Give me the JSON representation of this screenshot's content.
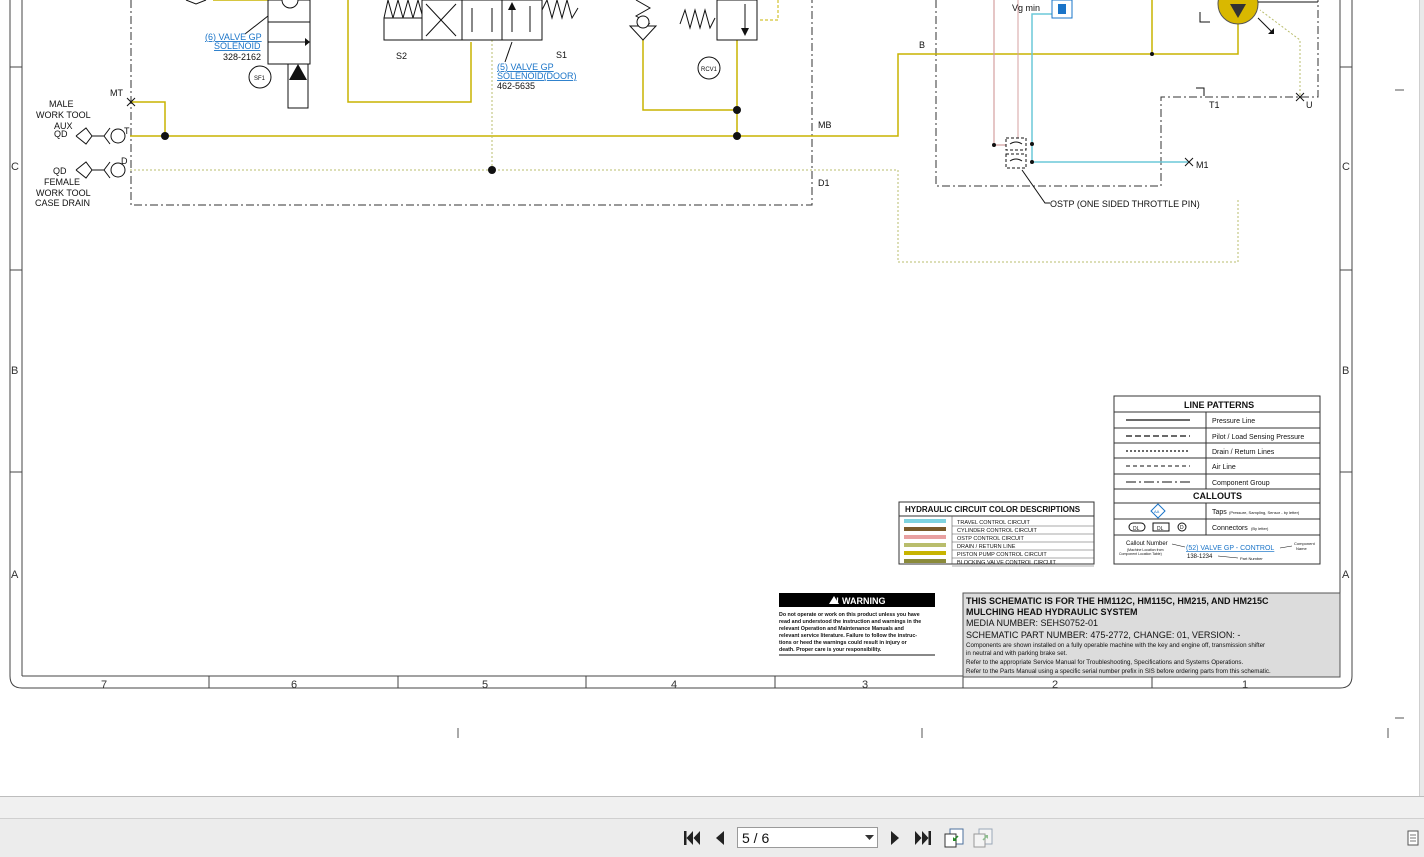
{
  "schematic": {
    "border_columns": [
      "7",
      "6",
      "5",
      "4",
      "3",
      "2",
      "1"
    ],
    "border_rows": [
      "C",
      "B",
      "A"
    ],
    "labels": {
      "valve6_link": "(6) VALVE GP",
      "valve6_link2": "SOLENOID",
      "valve6_part": "328-2162",
      "sf1": "SF1",
      "s2": "S2",
      "s1": "S1",
      "valve5_link": "(5) VALVE GP",
      "valve5_link2": "SOLENOID(DOOR)",
      "valve5_part": "462-5635",
      "rcv1": "RCV1",
      "mt": "MT",
      "male1": "MALE",
      "male2": "WORK TOOL",
      "aux": "AUX",
      "qd1": "QD",
      "t": "T",
      "qd2": "QD",
      "d": "D",
      "female1": "FEMALE",
      "female2": "WORK TOOL",
      "female3": "CASE DRAIN",
      "mb": "MB",
      "d1": "D1",
      "b": "B",
      "vgmin": "Vg min",
      "t1": "T1",
      "u": "U",
      "m1": "M1",
      "ostp": "OSTP (ONE SIDED THROTTLE PIN)"
    },
    "color_legend": {
      "title": "HYDRAULIC CIRCUIT COLOR DESCRIPTIONS",
      "items": [
        {
          "label": "TRAVEL CONTROL CIRCUIT",
          "color": "#7fd3e0"
        },
        {
          "label": "CYLINDER CONTROL CIRCUIT",
          "color": "#7a5a2a"
        },
        {
          "label": "OSTP CONTROL CIRCUIT",
          "color": "#e8a0a0"
        },
        {
          "label": "DRAIN / RETURN LINE",
          "color": "#b9bd6c"
        },
        {
          "label": "PISTON PUMP CONTROL CIRCUIT",
          "color": "#c8b400"
        },
        {
          "label": "BLOCKING VALVE CONTROL CIRCUIT",
          "color": "#8a8a3a"
        }
      ]
    },
    "line_patterns": {
      "title": "LINE PATTERNS",
      "items": [
        "Pressure Line",
        "Pilot / Load Sensing Pressure",
        "Drain / Return Lines",
        "Air Line",
        "Component Group"
      ],
      "callouts_title": "CALLOUTS",
      "taps": "Taps",
      "taps_small": "(Pressure, Sampling, Sensor - by letter)",
      "connectors": "Connectors",
      "connectors_small": "(By letter)",
      "conn_dl": "DL",
      "conn_dl2": "DL",
      "conn_d": "D",
      "tap_letter": "AA",
      "callout_number": "Callout Number",
      "callout_small1": "(Machine Location from",
      "callout_small2": "Component Location Table)",
      "callout_link": "(52) VALVE GP - CONTROL",
      "component_name1": "Component",
      "component_name2": "Name",
      "part_number": "138-1234",
      "part_number_label": "Part Number"
    },
    "warning": {
      "title": "WARNING",
      "text": [
        "Do not operate or work on this product unless you have",
        "read and understood the instruction and warnings in the",
        "relevant Operation and Maintenance Manuals and",
        "relevant service literature. Failure to follow the instruc-",
        "tions or heed the warnings could result in injury or",
        "death. Proper care is your responsibility."
      ]
    },
    "title_block": {
      "line1": "THIS SCHEMATIC IS FOR THE HM112C, HM115C, HM215, AND HM215C",
      "line2": "MULCHING HEAD HYDRAULIC SYSTEM",
      "media": "MEDIA NUMBER: SEHS0752-01",
      "part": "SCHEMATIC PART NUMBER: 475-2772, CHANGE: 01, VERSION: -",
      "note1": "Components are shown installed on a fully operable machine with the key and engine off, transmission shifter",
      "note2": "in neutral and with parking brake set.",
      "note3": "Refer to the appropriate Service Manual for Troubleshooting, Specifications and Systems Operations.",
      "note4": "Refer to the Parts Manual using a specific serial number prefix in SIS before ordering parts from this schematic."
    },
    "colors": {
      "yellow_line": "#c8b400",
      "cyan_line": "#6cc8d8",
      "drain_line": "#b9bd6c",
      "pink_line": "#d4a0a0",
      "link_blue": "#1a74c8"
    }
  },
  "toolbar": {
    "page_value": "5 / 6",
    "first_page": "first-page-icon",
    "prev_page": "previous-page-icon",
    "next_page": "next-page-icon",
    "last_page": "last-page-icon",
    "fit_page": "fit-page-icon",
    "fit_width": "fit-width-icon"
  }
}
